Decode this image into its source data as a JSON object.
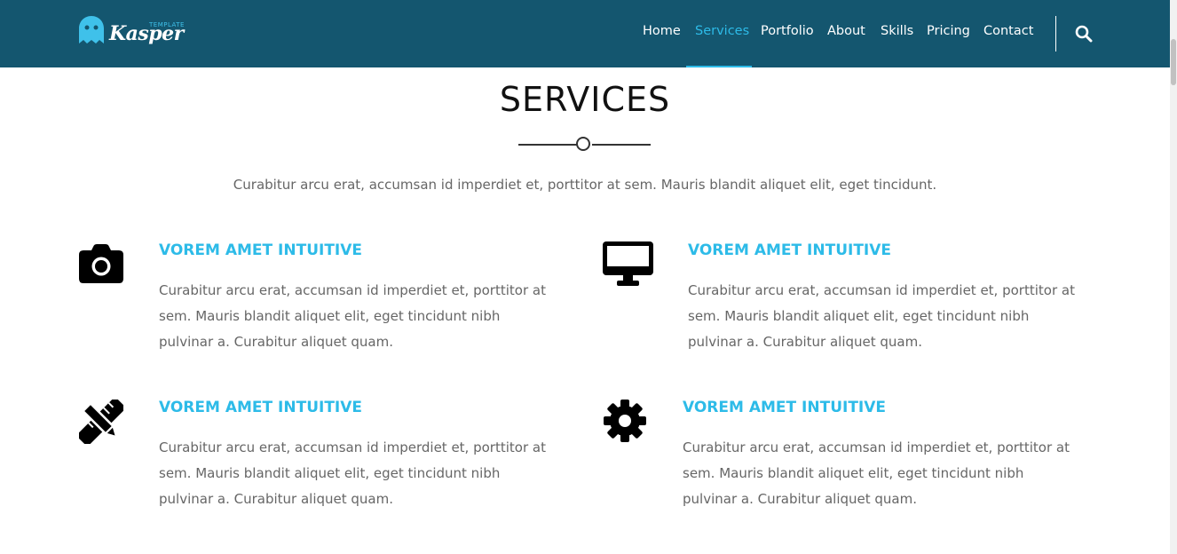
{
  "header": {
    "logo_word": "Kasper",
    "logo_tag": "TEMPLATE",
    "nav": [
      {
        "label": "Home"
      },
      {
        "label": "Services",
        "active": true
      },
      {
        "label": "Portfolio"
      },
      {
        "label": "About"
      },
      {
        "label": "Skills"
      },
      {
        "label": "Pricing"
      },
      {
        "label": "Contact"
      }
    ]
  },
  "section": {
    "title": "SERVICES",
    "subtitle": "Curabitur arcu erat, accumsan id imperdiet et, porttitor at sem. Mauris blandit aliquet elit, eget tincidunt.",
    "services": [
      {
        "icon": "camera-icon",
        "title": "VOREM AMET INTUITIVE",
        "text": "Curabitur arcu erat, accumsan id imperdiet et, porttitor at sem. Mauris blandit aliquet elit, eget tincidunt nibh pulvinar a. Curabitur aliquet quam."
      },
      {
        "icon": "desktop-icon",
        "title": "VOREM AMET INTUITIVE",
        "text": "Curabitur arcu erat, accumsan id imperdiet et, porttitor at sem. Mauris blandit aliquet elit, eget tincidunt nibh pulvinar a. Curabitur aliquet quam."
      },
      {
        "icon": "pencil-ruler-icon",
        "title": "VOREM AMET INTUITIVE",
        "text": "Curabitur arcu erat, accumsan id imperdiet et, porttitor at sem. Mauris blandit aliquet elit, eget tincidunt nibh pulvinar a. Curabitur aliquet quam."
      },
      {
        "icon": "gear-icon",
        "title": "VOREM AMET INTUITIVE",
        "text": "Curabitur arcu erat, accumsan id imperdiet et, porttitor at sem. Mauris blandit aliquet elit, eget tincidunt nibh pulvinar a. Curabitur aliquet quam."
      }
    ]
  },
  "colors": {
    "header_bg": "#14566f",
    "accent": "#2dbbe8",
    "text": "#666666"
  }
}
